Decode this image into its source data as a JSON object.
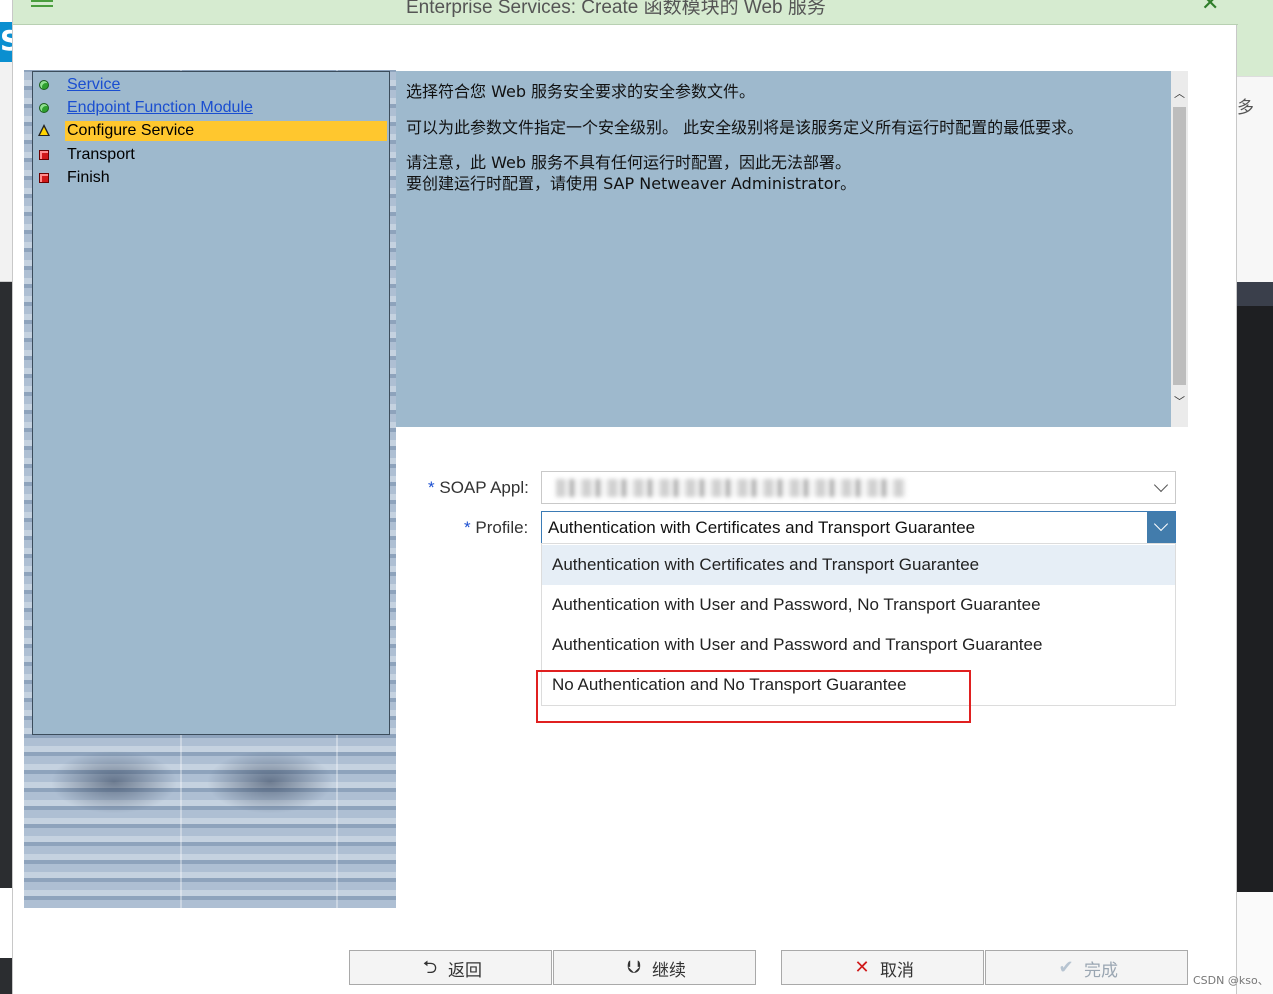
{
  "dialog": {
    "title": "Enterprise Services: Create 函数模块的 Web 服务",
    "menu_icon": "hamburger-menu-icon",
    "close_icon": "close-icon"
  },
  "wizard": {
    "steps": [
      {
        "label": "Service",
        "status": "done",
        "icon": "green-dot-icon",
        "link": true
      },
      {
        "label": "Endpoint Function Module",
        "status": "done",
        "icon": "green-dot-icon",
        "link": true
      },
      {
        "label": "Configure Service",
        "status": "current",
        "icon": "warning-triangle-icon",
        "link": false
      },
      {
        "label": "Transport",
        "status": "pending",
        "icon": "red-square-icon",
        "link": false
      },
      {
        "label": "Finish",
        "status": "pending",
        "icon": "red-square-icon",
        "link": false
      }
    ]
  },
  "info": {
    "line1": "选择符合您 Web 服务安全要求的安全参数文件。",
    "line2": "可以为此参数文件指定一个安全级别。 此安全级别将是该服务定义所有运行时配置的最低要求。",
    "line3": "请注意，此 Web 服务不具有任何运行时配置，因此无法部署。",
    "line4": "要创建运行时配置，请使用 SAP Netweaver Administrator。"
  },
  "form": {
    "required_mark": "*",
    "soap_label": "SOAP Appl:",
    "profile_label": "Profile:",
    "profile_value": "Authentication with Certificates and Transport Guarantee",
    "profile_options": [
      "Authentication with Certificates and Transport Guarantee",
      "Authentication with User and Password, No Transport Guarantee",
      "Authentication with User and Password and Transport Guarantee",
      "No Authentication and No Transport Guarantee"
    ]
  },
  "footer": {
    "back_label": "返回",
    "continue_label": "继续",
    "cancel_label": "取消",
    "complete_label": "完成"
  },
  "background": {
    "left_letter": "S",
    "right_more": "多"
  },
  "watermark": "CSDN @kso、",
  "colors": {
    "titlebar": "#d6ebd0",
    "panel": "#9eb9cd",
    "current_step": "#ffc72e",
    "link": "#1a4ed0",
    "dropdown_button": "#427cac",
    "highlight": "#e02020"
  }
}
